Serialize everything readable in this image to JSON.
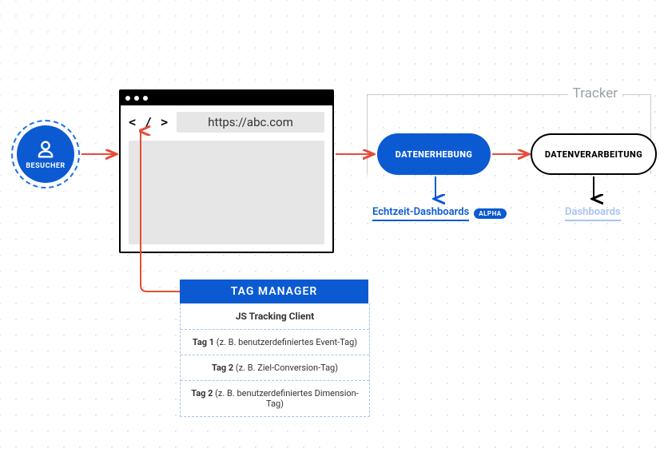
{
  "visitor": {
    "label": "BESUCHER"
  },
  "browser": {
    "url": "https://abc.com",
    "code_icon": "< / >"
  },
  "tracker": {
    "group_label": "Tracker",
    "collect": {
      "label": "DATENERHEBUNG"
    },
    "process": {
      "label": "DATENVERARBEITUNG"
    },
    "realtime_link": "Echtzeit-Dashboards",
    "realtime_badge": "ALPHA",
    "dashboards_link": "Dashboards"
  },
  "tag_manager": {
    "header": "TAG MANAGER",
    "rows": [
      {
        "bold": "JS Tracking Client",
        "rest": ""
      },
      {
        "bold": "Tag 1",
        "rest": " (z. B. benutzerdefiniertes Event-Tag)"
      },
      {
        "bold": "Tag 2",
        "rest": " (z. B. Ziel-Conversion-Tag)"
      },
      {
        "bold": "Tag 2",
        "rest": " (z. B. benutzerdefiniertes Dimension-Tag)"
      }
    ]
  }
}
